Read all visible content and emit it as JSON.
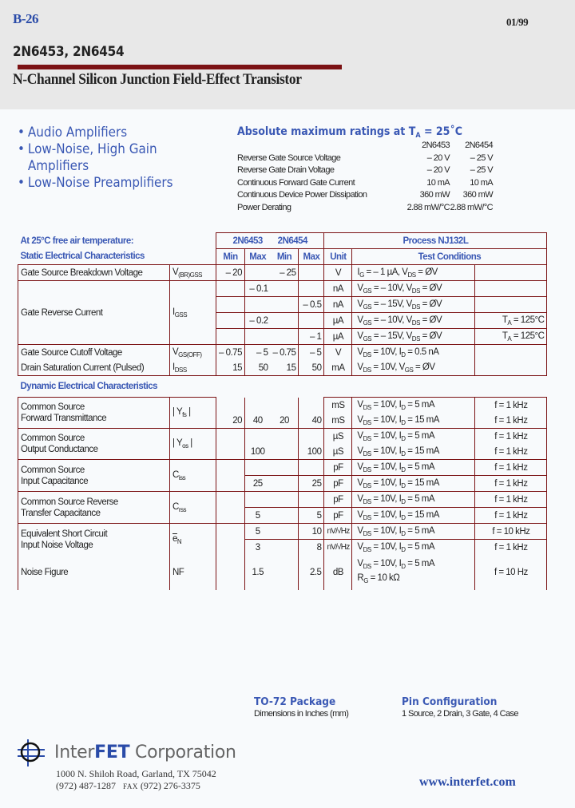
{
  "header": {
    "page_code": "B-26",
    "date": "01/99",
    "part_numbers": "2N6453, 2N6454",
    "subtitle": "N-Channel Silicon Junction Field-Effect Transistor"
  },
  "features": [
    "Audio Amplifiers",
    "Low-Noise, High Gain",
    "Amplifiers",
    "Low-Noise Preamplifiers"
  ],
  "abs_max": {
    "title_prefix": "Absolute maximum ratings at T",
    "title_sub": "A",
    "title_suffix": " = 25˚C",
    "col1": "2N6453",
    "col2": "2N6454",
    "rows": [
      {
        "label": "Reverse Gate Source Voltage",
        "v1": "– 20 V",
        "v2": "– 25 V"
      },
      {
        "label": "Reverse Gate Drain Voltage",
        "v1": "– 20 V",
        "v2": "– 25 V"
      },
      {
        "label": "Continuous Forward Gate Current",
        "v1": "10 mA",
        "v2": "10 mA"
      },
      {
        "label": "Continuous Device Power Dissipation",
        "v1": "360 mW",
        "v2": "360 mW"
      },
      {
        "label": "Power Derating",
        "v1": "2.88 mW/°C",
        "v2": "2.88 mW/°C"
      }
    ]
  },
  "spec_table": {
    "temp_note": "At 25°C free air temperature:",
    "static_heading": "Static Electrical Characteristics",
    "dynamic_heading": "Dynamic Electrical Characteristics",
    "part1": "2N6453",
    "part2": "2N6454",
    "process": "Process NJ132L",
    "min": "Min",
    "max": "Max",
    "unit": "Unit",
    "test_conditions": "Test Conditions",
    "static": {
      "breakdown": {
        "label": "Gate Source Breakdown Voltage",
        "sym": "V",
        "sym_sub": "(BR)GSS",
        "min1": "– 20",
        "min2": "– 25",
        "unit": "V",
        "cond": "I",
        "cond_sub": "G",
        "cond_rest": " = – 1 µA, V",
        "cond_sub2": "DS",
        "cond_end": " = ØV"
      },
      "igss": {
        "label": "Gate Reverse Current",
        "sym": "I",
        "sym_sub": "GSS",
        "rows": [
          {
            "max1": "– 0.1",
            "max2": "",
            "unit": "nA",
            "vgs": "– 10V",
            "extra": ""
          },
          {
            "max1": "",
            "max2": "– 0.5",
            "unit": "nA",
            "vgs": "– 15V",
            "extra": ""
          },
          {
            "max1": "– 0.2",
            "max2": "",
            "unit": "µA",
            "vgs": "– 10V",
            "extra": "125°C"
          },
          {
            "max1": "",
            "max2": "– 1",
            "unit": "µA",
            "vgs": "– 15V",
            "extra": "125°C"
          }
        ]
      },
      "cutoff": {
        "label": "Gate Source Cutoff Voltage",
        "sym": "V",
        "sym_sub": "GS(OFF)",
        "min1": "– 0.75",
        "max1": "– 5",
        "min2": "– 0.75",
        "max2": "– 5",
        "unit": "V",
        "cond_a": " = 10V, I",
        "cond_b": " = 0.5 nA"
      },
      "idss": {
        "label": "Drain Saturation Current (Pulsed)",
        "sym": "I",
        "sym_sub": "DSS",
        "min1": "15",
        "max1": "50",
        "min2": "15",
        "max2": "50",
        "unit": "mA",
        "cond_a": " = 10V, V",
        "cond_b": " = ØV"
      }
    },
    "dynamic": {
      "yfs": {
        "label1": "Common Source",
        "label2": "Forward Transmittance",
        "sym": "| Y",
        "sym_sub": "fs",
        "sym_end": " |",
        "min1": "20",
        "max1": "40",
        "min2": "20",
        "max2": "40",
        "unit1": "mS",
        "unit2": "mS",
        "id1": "5 mA",
        "id2": "15 mA",
        "f1": "f = 1 kHz",
        "f2": "f = 1 kHz"
      },
      "yos": {
        "label1": "Common Source",
        "label2": "Output Conductance",
        "sym": "| Y",
        "sym_sub": "os",
        "sym_end": " |",
        "max1": "100",
        "max2": "100",
        "unit1": "µS",
        "unit2": "µS",
        "id1": "5 mA",
        "id2": "15 mA",
        "f1": "f = 1 kHz",
        "f2": "f = 1 kHz"
      },
      "ciss": {
        "label1": "Common Source",
        "label2": "Input Capacitance",
        "sym": "C",
        "sym_sub": "iss",
        "max1": "25",
        "max2": "25",
        "unit1": "pF",
        "unit2": "pF",
        "id1": "5 mA",
        "id2": "15 mA",
        "f1": "f = 1 kHz",
        "f2": "f = 1 kHz"
      },
      "crss": {
        "label1": "Common Source Reverse",
        "label2": "Transfer Capacitance",
        "sym": "C",
        "sym_sub": "rss",
        "max1": "5",
        "max2": "5",
        "unit1": "pF",
        "unit2": "pF",
        "id1": "5 mA",
        "id2": "15 mA",
        "f1": "f = 1 kHz",
        "f2": "f = 1 kHz"
      },
      "en": {
        "label1": "Equivalent Short Circuit",
        "label2": "Input Noise Voltage",
        "sym": "e",
        "sym_sub": "N",
        "max1a": "5",
        "max2a": "10",
        "max1b": "3",
        "max2b": "8",
        "unit": "nV/√Hz",
        "id": "5 mA",
        "f1": "f = 10 kHz",
        "f2": "f = 1 kHz"
      },
      "nf": {
        "label": "Noise Figure",
        "sym": "NF",
        "max1": "1.5",
        "max2": "2.5",
        "unit": "dB",
        "id": "5 mA",
        "rg": " = 10 kΩ",
        "f": "f = 10 Hz"
      }
    }
  },
  "package": {
    "title": "TO-72 Package",
    "subtitle": "Dimensions in Inches (mm)"
  },
  "pin_config": {
    "title": "Pin Configuration",
    "subtitle": "1 Source, 2 Drain, 3 Gate, 4 Case"
  },
  "footer": {
    "company_a": "Inter",
    "company_b": "FET",
    "company_c": " Corporation",
    "address": "1000 N. Shiloh Road, Garland, TX 75042",
    "phone": "(972) 487-1287",
    "fax_label": "FAX",
    "fax": "(972) 276-3375",
    "website": "www.interfet.com"
  },
  "colors": {
    "accent_blue": "#3a58b4",
    "rule_red": "#7b1214",
    "header_band": "#e8e8e8"
  }
}
